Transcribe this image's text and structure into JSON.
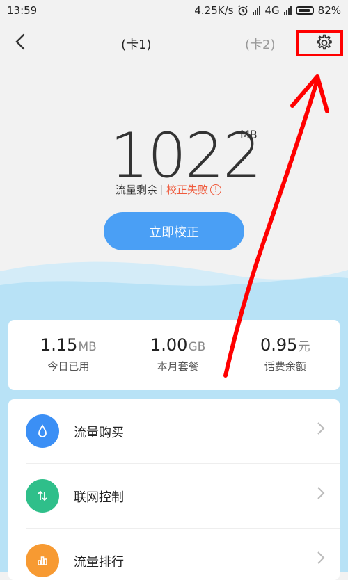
{
  "status": {
    "time": "13:59",
    "speed": "4.25K/s",
    "network": "4G",
    "battery": "82%"
  },
  "header": {
    "tab1": "(卡1)",
    "tab2": "(卡2)"
  },
  "data": {
    "remaining_value": "1022",
    "unit": "MB",
    "remaining_label": "流量剩余",
    "calibration_status": "校正失败",
    "warn_glyph": "!"
  },
  "button": {
    "label": "立即校正"
  },
  "stats": [
    {
      "value": "1.15",
      "unit": "MB",
      "label": "今日已用"
    },
    {
      "value": "1.00",
      "unit": "GB",
      "label": "本月套餐"
    },
    {
      "value": "0.95",
      "unit": "元",
      "label": "话费余额"
    }
  ],
  "menu": [
    {
      "label": "流量购买",
      "icon": "water-drop-icon",
      "color": "#3b8ff5"
    },
    {
      "label": "联网控制",
      "icon": "up-down-arrows-icon",
      "color": "#2fbf8a"
    },
    {
      "label": "流量排行",
      "icon": "bar-chart-icon",
      "color": "#f79a32"
    }
  ],
  "colors": {
    "accent": "#4a9ff5",
    "error": "#ef5a3c",
    "annotation": "#ff0000"
  }
}
